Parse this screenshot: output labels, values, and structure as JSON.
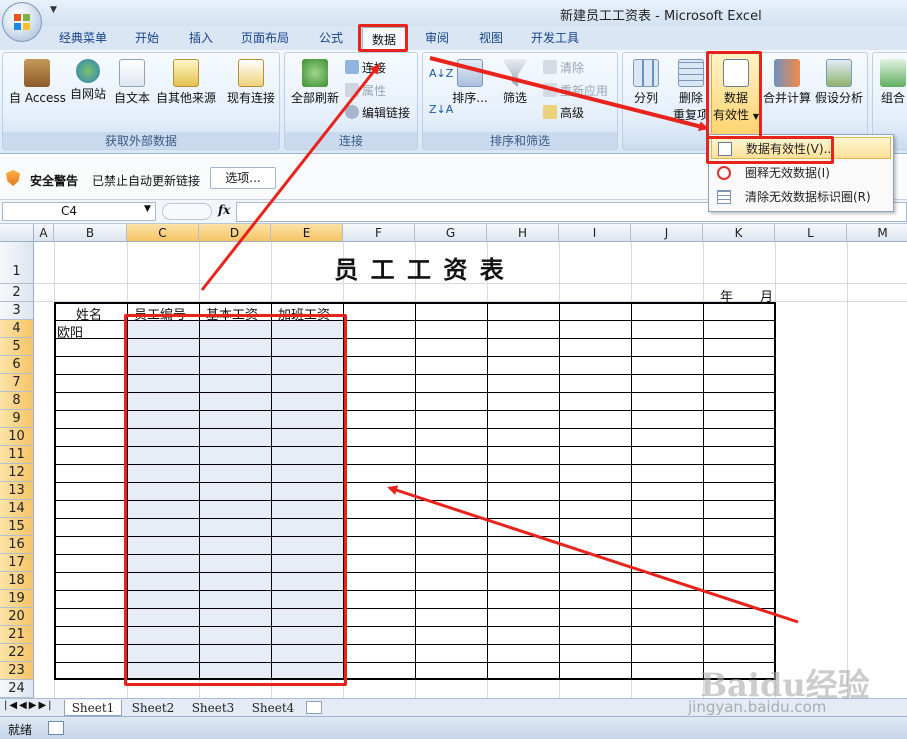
{
  "window": {
    "title": "新建员工工资表 - Microsoft Excel"
  },
  "ribbon_tabs": [
    "经典菜单",
    "开始",
    "插入",
    "页面布局",
    "公式",
    "数据",
    "审阅",
    "视图",
    "开发工具"
  ],
  "active_tab": "数据",
  "groups": {
    "external": {
      "label": "获取外部数据",
      "buttons": [
        "自 Access",
        "自网站",
        "自文本",
        "自其他来源",
        "现有连接"
      ]
    },
    "connections": {
      "label": "连接",
      "refresh_all": "全部刷新",
      "items": [
        "连接",
        "属性",
        "编辑链接"
      ]
    },
    "sort_filter": {
      "label": "排序和筛选",
      "sort": "排序...",
      "filter": "筛选",
      "items": [
        "清除",
        "重新应用",
        "高级"
      ]
    },
    "data_tools": {
      "split": "分列",
      "remove_dup_1": "删除",
      "remove_dup_2": "重复项",
      "validation_1": "数据",
      "validation_2": "有效性",
      "consolidate": "合并计算",
      "whatif": "假设分析"
    },
    "outline": {
      "group": "组合"
    }
  },
  "dropdown_menu": {
    "items": [
      "数据有效性(V)...",
      "圈释无效数据(I)",
      "清除无效数据标识圈(R)"
    ]
  },
  "security_bar": {
    "title": "安全警告",
    "message": "已禁止自动更新链接",
    "options_button": "选项..."
  },
  "formula_bar": {
    "name_box": "C4",
    "fx": "fx",
    "formula": ""
  },
  "grid": {
    "columns": [
      "A",
      "B",
      "C",
      "D",
      "E",
      "F",
      "G",
      "H",
      "I",
      "J",
      "K",
      "L",
      "M"
    ],
    "rows": [
      "1",
      "2",
      "3",
      "4",
      "5",
      "6",
      "7",
      "8",
      "9",
      "10",
      "11",
      "12",
      "13",
      "14",
      "15",
      "16",
      "17",
      "18",
      "19",
      "20",
      "21",
      "22",
      "23",
      "24"
    ],
    "sheet_title": "员 工 工 资 表",
    "year_label": "年",
    "month_label": "月",
    "headers": [
      "姓名",
      "员工编号",
      "基本工资",
      "加班工资"
    ],
    "first_name": "欧阳"
  },
  "sheets": [
    "Sheet1",
    "Sheet2",
    "Sheet3",
    "Sheet4"
  ],
  "status": "就绪",
  "watermark": {
    "brand": "Baidu经验",
    "url": "jingyan.baidu.com"
  },
  "colors": {
    "annotation_red": "#e8231c",
    "selection_fill": "#e8ecf6",
    "ribbon_text": "#15428b"
  }
}
